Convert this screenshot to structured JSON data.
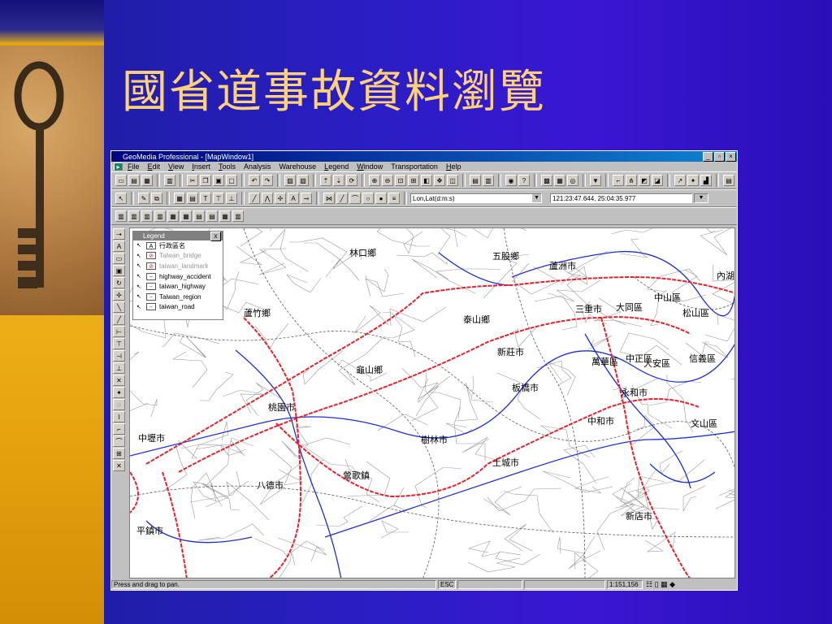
{
  "slide": {
    "title": "國省道事故資料瀏覽"
  },
  "app": {
    "title": "GeoMedia Professional - [MapWindow1]",
    "menu": [
      {
        "key": "F",
        "rest": "ile"
      },
      {
        "key": "E",
        "rest": "dit"
      },
      {
        "key": "V",
        "rest": "iew"
      },
      {
        "key": "I",
        "rest": "nsert"
      },
      {
        "key": "T",
        "rest": "ools"
      },
      {
        "key": "",
        "rest": "Analysis"
      },
      {
        "key": "",
        "rest": "Warehouse"
      },
      {
        "key": "L",
        "rest": "egend"
      },
      {
        "key": "W",
        "rest": "indow"
      },
      {
        "key": "",
        "rest": "Transportation"
      },
      {
        "key": "H",
        "rest": "elp"
      }
    ],
    "coord_system": "Lon,Lat(d:m:s)",
    "coord_readout": "121:23:47.644, 25:04:35.977",
    "status": {
      "message": "Press and drag to pan.",
      "key": "ESC",
      "scale": "1:151,156"
    }
  },
  "legend": {
    "title": "Legend",
    "close": "x",
    "items": [
      {
        "label": "行政區名",
        "symbol": "A",
        "dim": false
      },
      {
        "label": "Taiwan_bridge",
        "symbol": "⊘",
        "dim": true
      },
      {
        "label": "taiwan_landmark",
        "symbol": "⊘",
        "dim": true
      },
      {
        "label": "highway_accident",
        "symbol": "~",
        "dim": false
      },
      {
        "label": "taiwan_highway",
        "symbol": "~",
        "dim": false
      },
      {
        "label": "Taiwan_region",
        "symbol": "~",
        "dim": false
      },
      {
        "label": "taiwan_road",
        "symbol": "~",
        "dim": false
      }
    ]
  },
  "places": [
    "林口鄉",
    "五股鄉",
    "蘆洲市",
    "內湖",
    "中山區",
    "三重市",
    "大同區",
    "松山區",
    "蘆竹鄉",
    "泰山鄉",
    "新莊市",
    "萬華區",
    "中正區",
    "大安區",
    "信義區",
    "龜山鄉",
    "板橋市",
    "永和市",
    "桃園市",
    "中和市",
    "文山區",
    "中壢市",
    "樹林市",
    "土城市",
    "鶯歌鎮",
    "八德市",
    "新店市",
    "平鎮市"
  ],
  "colors": {
    "highway": "#e8202a",
    "road": "#1c2fd8",
    "minor": "#9a9a9a",
    "region": "#5a5a5a"
  }
}
